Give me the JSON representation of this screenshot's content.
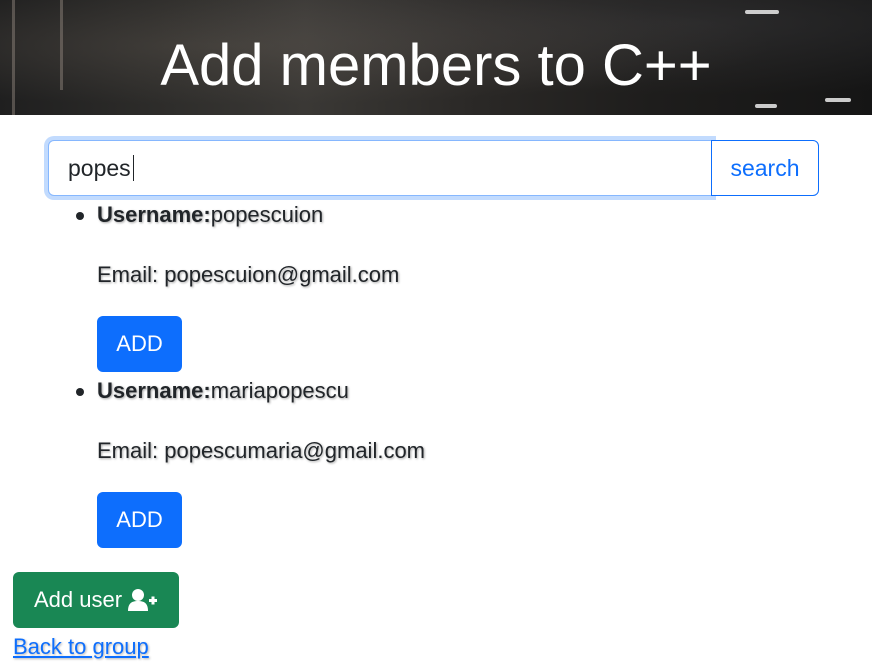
{
  "header": {
    "title": "Add members to C++"
  },
  "search": {
    "value": "popes",
    "button_label": "search"
  },
  "results": [
    {
      "username_label": "Username:",
      "username": "popescuion",
      "email_text": "Email: popescuion@gmail.com",
      "add_label": "ADD"
    },
    {
      "username_label": "Username:",
      "username": "mariapopescu",
      "email_text": "Email: popescumaria@gmail.com",
      "add_label": "ADD"
    }
  ],
  "footer": {
    "add_user_label": "Add user",
    "add_user_icon": "user-plus-icon",
    "back_link": "Back to group"
  },
  "colors": {
    "primary": "#0d6efd",
    "success": "#198754",
    "text": "#212529"
  }
}
